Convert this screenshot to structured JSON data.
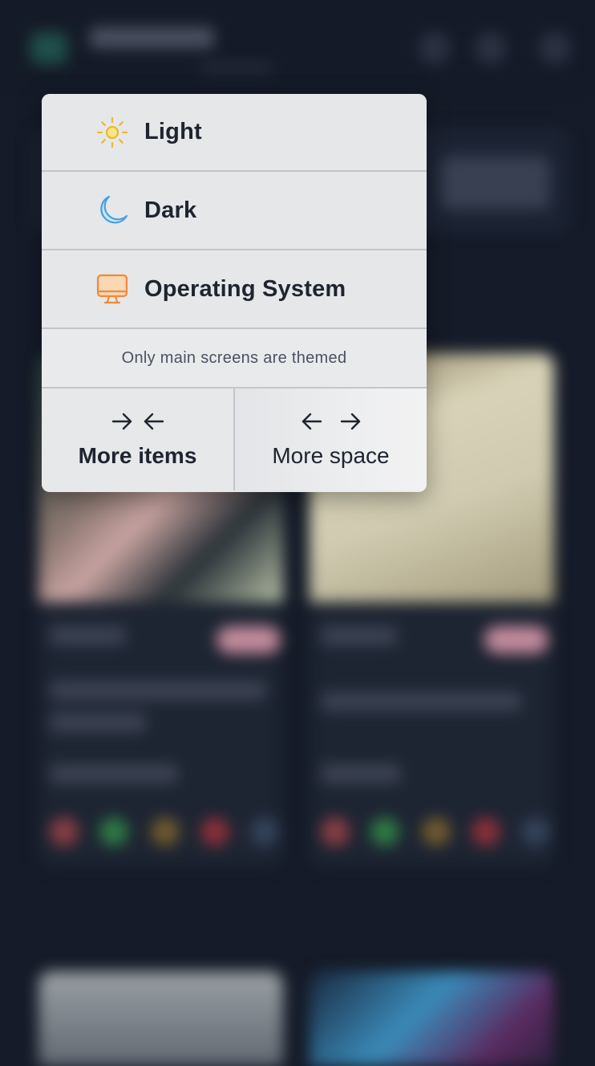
{
  "theme_menu": {
    "options": [
      {
        "label": "Light",
        "icon": "sun-icon",
        "color": "#e9b930"
      },
      {
        "label": "Dark",
        "icon": "moon-icon",
        "color": "#4aa0e0"
      },
      {
        "label": "Operating System",
        "icon": "monitor-icon",
        "color": "#ee8a3c"
      }
    ],
    "note": "Only main screens are themed"
  },
  "density": {
    "more_items_label": "More items",
    "more_space_label": "More space"
  },
  "colors": {
    "app_background": "#151b28",
    "menu_background": "#e6e7e9",
    "divider": "#c3c5ca",
    "text_primary": "#1e2530"
  }
}
